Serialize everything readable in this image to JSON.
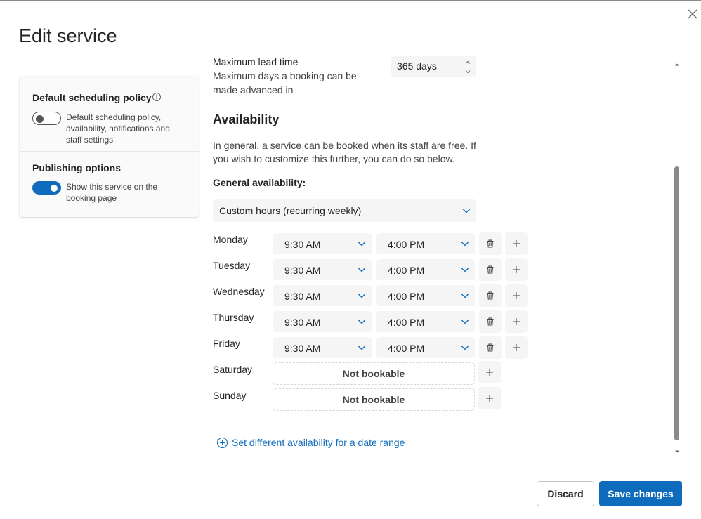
{
  "dialog": {
    "title": "Edit service",
    "close_icon": "close-icon"
  },
  "sidebar": {
    "default_policy": {
      "title": "Default scheduling policy",
      "info_icon": "info-icon",
      "toggle_on": false,
      "description": "Default scheduling policy, availability, notifications and staff settings"
    },
    "publishing": {
      "title": "Publishing options",
      "toggle_on": true,
      "description": "Show this service on the booking page"
    }
  },
  "lead_time": {
    "label": "Maximum lead time",
    "description": "Maximum days a booking can be made advanced in",
    "value": "365 days"
  },
  "availability": {
    "title": "Availability",
    "description": "In general, a service can be booked when its staff are free. If you wish to customize this further, you can do so below.",
    "general_label": "General availability:",
    "general_value": "Custom hours (recurring weekly)",
    "days": [
      {
        "name": "Monday",
        "start": "9:30 AM",
        "end": "4:00 PM",
        "bookable": true
      },
      {
        "name": "Tuesday",
        "start": "9:30 AM",
        "end": "4:00 PM",
        "bookable": true
      },
      {
        "name": "Wednesday",
        "start": "9:30 AM",
        "end": "4:00 PM",
        "bookable": true
      },
      {
        "name": "Thursday",
        "start": "9:30 AM",
        "end": "4:00 PM",
        "bookable": true
      },
      {
        "name": "Friday",
        "start": "9:30 AM",
        "end": "4:00 PM",
        "bookable": true
      },
      {
        "name": "Saturday",
        "bookable": false,
        "status": "Not bookable"
      },
      {
        "name": "Sunday",
        "bookable": false,
        "status": "Not bookable"
      }
    ],
    "range_link": "Set different availability for a date range"
  },
  "footer": {
    "discard_label": "Discard",
    "save_label": "Save changes"
  },
  "colors": {
    "accent": "#0f6cbd",
    "field_bg": "#f5f5f5"
  }
}
